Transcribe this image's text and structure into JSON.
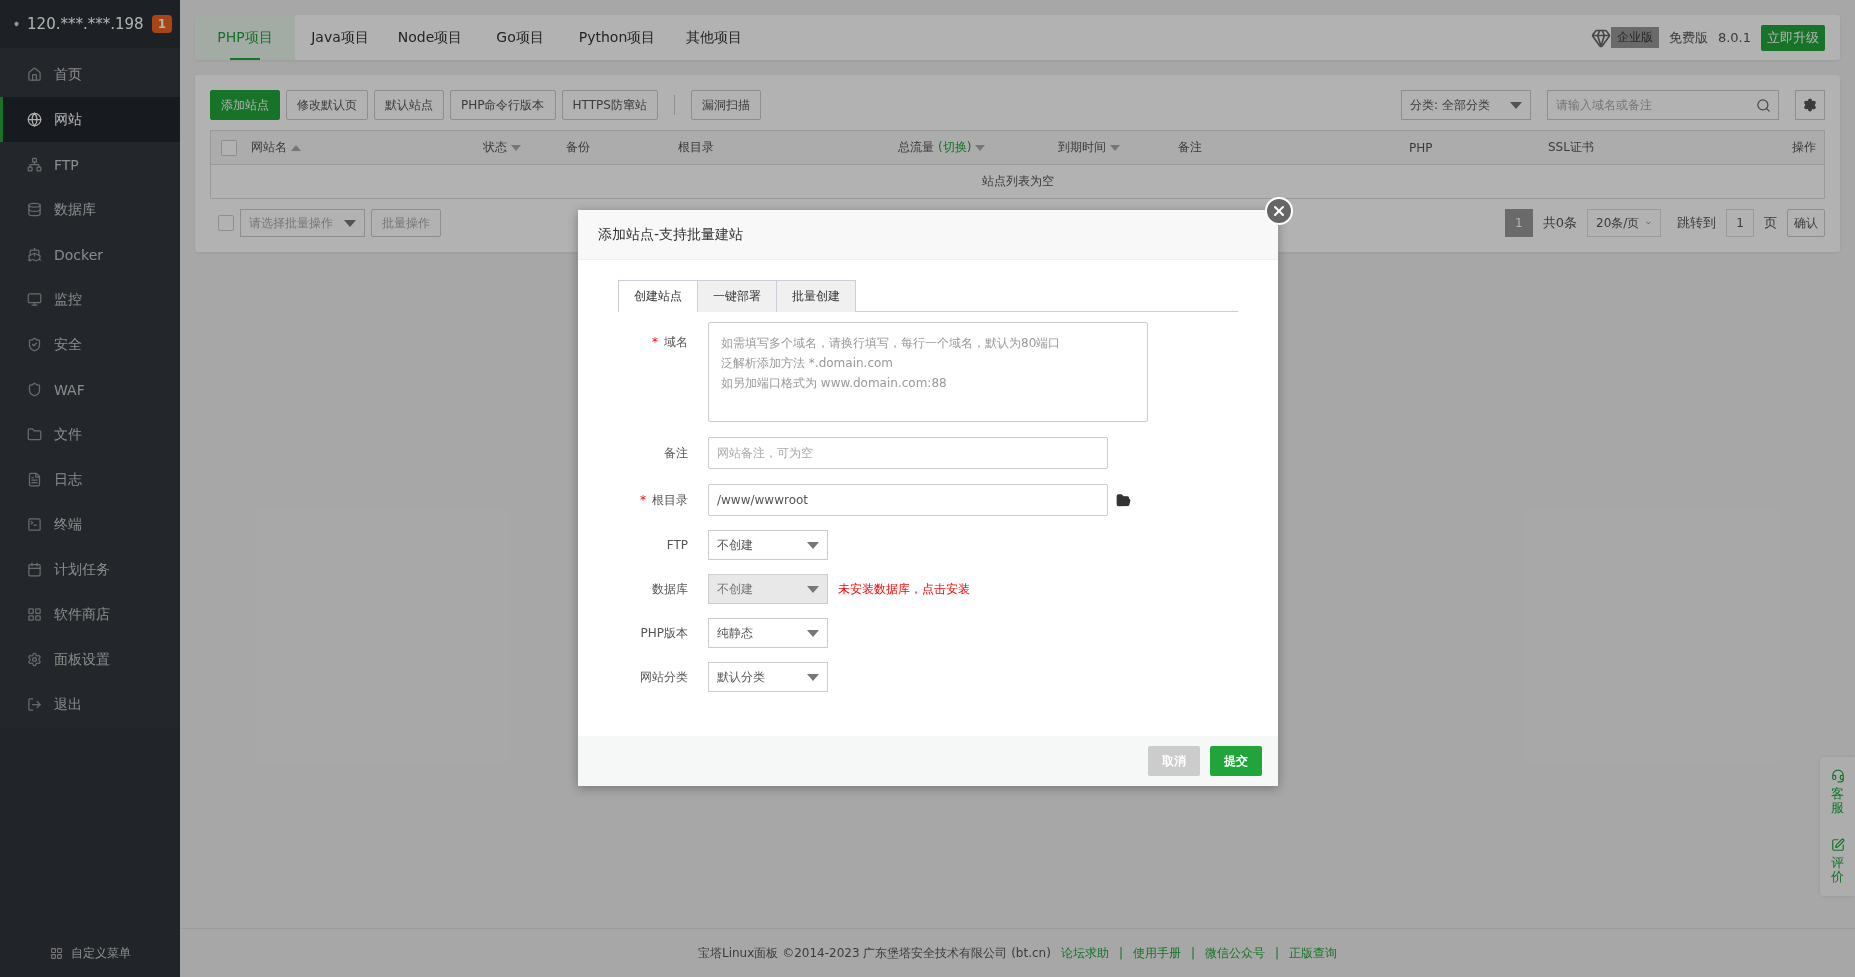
{
  "sidebar": {
    "server": "120.***.***.198",
    "badge": "1",
    "items": [
      {
        "label": "首页",
        "selected": false
      },
      {
        "label": "网站",
        "selected": true
      },
      {
        "label": "FTP",
        "selected": false
      },
      {
        "label": "数据库",
        "selected": false
      },
      {
        "label": "Docker",
        "selected": false
      },
      {
        "label": "监控",
        "selected": false
      },
      {
        "label": "安全",
        "selected": false
      },
      {
        "label": "WAF",
        "selected": false
      },
      {
        "label": "文件",
        "selected": false
      },
      {
        "label": "日志",
        "selected": false
      },
      {
        "label": "终端",
        "selected": false
      },
      {
        "label": "计划任务",
        "selected": false
      },
      {
        "label": "软件商店",
        "selected": false
      },
      {
        "label": "面板设置",
        "selected": false
      },
      {
        "label": "退出",
        "selected": false
      }
    ],
    "custom_menu": "自定义菜单"
  },
  "project_tabs": [
    {
      "label": "PHP项目",
      "selected": true
    },
    {
      "label": "Java项目",
      "selected": false
    },
    {
      "label": "Node项目",
      "selected": false
    },
    {
      "label": "Go项目",
      "selected": false
    },
    {
      "label": "Python项目",
      "selected": false
    },
    {
      "label": "其他项目",
      "selected": false
    }
  ],
  "version": {
    "enterprise": "企业版",
    "edition": "免费版",
    "number": "8.0.1",
    "upgrade": "立即升级"
  },
  "toolbar": {
    "buttons": [
      {
        "label": "添加站点",
        "primary": true
      },
      {
        "label": "修改默认页",
        "primary": false
      },
      {
        "label": "默认站点",
        "primary": false
      },
      {
        "label": "PHP命令行版本",
        "primary": false
      },
      {
        "label": "HTTPS防窜站",
        "primary": false
      }
    ],
    "extra_button": "漏洞扫描",
    "category": "分类: 全部分类",
    "search_placeholder": "请输入域名或备注"
  },
  "table": {
    "select_all_checked": false,
    "columns": [
      {
        "label": "网站名",
        "sortable": true,
        "ascending": true
      },
      {
        "label": "状态",
        "sortable": true,
        "ascending": false
      },
      {
        "label": "备份"
      },
      {
        "label": "根目录"
      },
      {
        "label": "总流量",
        "link": "(切换)",
        "sortable": true,
        "ascending": false
      },
      {
        "label": "到期时间",
        "sortable": true,
        "ascending": false
      },
      {
        "label": "备注"
      },
      {
        "label": "PHP"
      },
      {
        "label": "SSL证书"
      },
      {
        "label": "操作"
      }
    ],
    "empty": "站点列表为空"
  },
  "batch": {
    "checked": false,
    "placeholder": "请选择批量操作",
    "button": "批量操作"
  },
  "pagination": {
    "pages": [
      {
        "label": "1",
        "selected": true
      }
    ],
    "total": "共0条",
    "page_size": "20条/页",
    "jump_label": "跳转到",
    "jump_value": "1",
    "page_unit": "页",
    "confirm": "确认"
  },
  "footer": {
    "text": "宝塔Linux面板 ©2014-2023 广东堡塔安全技术有限公司 (bt.cn)",
    "separator": "|",
    "links": [
      "论坛求助",
      "使用手册",
      "微信公众号",
      "正版查询"
    ]
  },
  "side_widget": [
    {
      "label": "客服"
    },
    {
      "label": "评价"
    }
  ],
  "modal": {
    "title": "添加站点-支持批量建站",
    "tabs": [
      {
        "label": "创建站点",
        "selected": true
      },
      {
        "label": "一键部署",
        "selected": false
      },
      {
        "label": "批量创建",
        "selected": false
      }
    ],
    "fields": [
      {
        "kind": "textarea",
        "label": "域名",
        "required_mark": "*",
        "placeholder": [
          "如需填写多个域名，请换行填写，每行一个域名，默认为80端口",
          "泛解析添加方法 *.domain.com",
          "如另加端口格式为 www.domain.com:88"
        ]
      },
      {
        "kind": "input",
        "label": "备注",
        "placeholder": "网站备注，可为空"
      },
      {
        "kind": "path",
        "label": "根目录",
        "required_mark": "*",
        "value": "/www/wwwroot"
      },
      {
        "kind": "select",
        "label": "FTP",
        "value": "不创建",
        "disabled": false
      },
      {
        "kind": "select",
        "label": "数据库",
        "value": "不创建",
        "disabled": true,
        "hint": "未安装数据库，点击安装"
      },
      {
        "kind": "select",
        "label": "PHP版本",
        "value": "纯静态",
        "disabled": false
      },
      {
        "kind": "select",
        "label": "网站分类",
        "value": "默认分类",
        "disabled": false
      }
    ],
    "buttons": [
      {
        "label": "取消",
        "primary": false
      },
      {
        "label": "提交",
        "primary": true
      }
    ]
  }
}
